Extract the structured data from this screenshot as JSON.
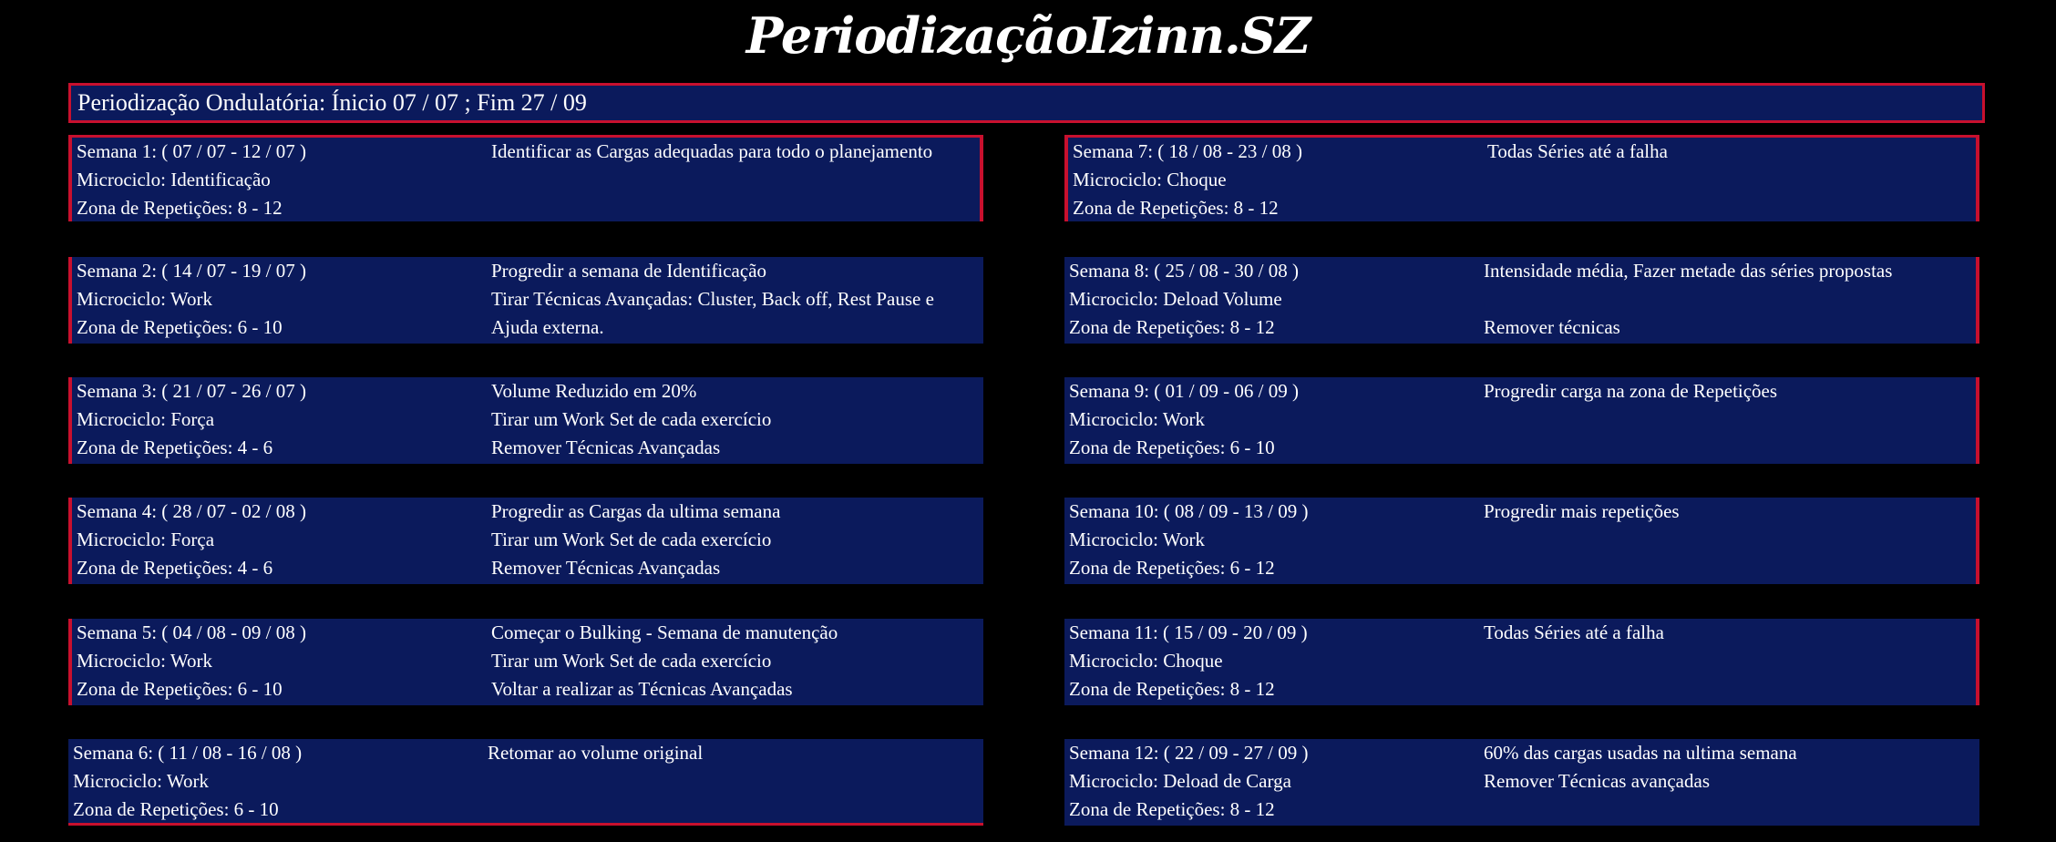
{
  "title": "PeriodizaçãoIzinn.SZ",
  "header": "Periodização Ondulatória:  Ínicio 07 / 07 ; Fim 27 / 09",
  "weeks_left": [
    {
      "semana": "Semana 1: ( 07 / 07 - 12 / 07 )",
      "microciclo": "Microciclo: Identificação",
      "zona": "Zona de Repetições: 8 - 12",
      "notes": [
        "Identificar as Cargas adequadas para todo o planejamento",
        "",
        ""
      ]
    },
    {
      "semana": "Semana 2: ( 14 / 07 - 19 / 07 )",
      "microciclo": "Microciclo: Work",
      "zona": "Zona de Repetições: 6 - 10",
      "notes": [
        "Progredir a semana de Identificação",
        "Tirar Técnicas Avançadas: Cluster, Back off, Rest Pause e",
        "Ajuda externa."
      ]
    },
    {
      "semana": "Semana 3: ( 21 / 07 - 26 / 07 )",
      "microciclo": "Microciclo: Força",
      "zona": "Zona de Repetições: 4 - 6",
      "notes": [
        "Volume Reduzido em 20%",
        "Tirar um Work Set de cada exercício",
        "Remover Técnicas Avançadas"
      ]
    },
    {
      "semana": "Semana 4: ( 28 / 07 - 02 / 08 )",
      "microciclo": "Microciclo: Força",
      "zona": "Zona de Repetições: 4 - 6",
      "notes": [
        "Progredir as Cargas da ultima semana",
        "Tirar um Work Set de cada exercício",
        "Remover Técnicas Avançadas"
      ]
    },
    {
      "semana": "Semana 5: ( 04 / 08 - 09 / 08 )",
      "microciclo": "Microciclo: Work",
      "zona": "Zona de Repetições: 6 - 10",
      "notes": [
        "Começar o Bulking - Semana de manutenção",
        "Tirar um Work Set de cada exercício",
        "Voltar a realizar as Técnicas Avançadas"
      ]
    },
    {
      "semana": "Semana 6: ( 11 / 08 - 16 / 08 )",
      "microciclo": "Microciclo: Work",
      "zona": "Zona de Repetições: 6 - 10",
      "notes": [
        "Retomar ao volume original",
        "",
        ""
      ]
    }
  ],
  "weeks_right": [
    {
      "semana": "Semana 7: ( 18 / 08 - 23 / 08 )",
      "microciclo": "Microciclo: Choque",
      "zona": "Zona de Repetições: 8 - 12",
      "notes": [
        "Todas Séries até a falha",
        "",
        ""
      ]
    },
    {
      "semana": "Semana 8: ( 25 / 08 - 30 / 08 )",
      "microciclo": "Microciclo: Deload Volume",
      "zona": "Zona de Repetições: 8 - 12",
      "notes": [
        "Intensidade média, Fazer metade das séries propostas",
        "",
        "Remover técnicas"
      ]
    },
    {
      "semana": "Semana 9: ( 01 / 09 - 06 / 09 )",
      "microciclo": "Microciclo: Work",
      "zona": "Zona de Repetições: 6 - 10",
      "notes": [
        "Progredir carga na zona de Repetições",
        "",
        ""
      ]
    },
    {
      "semana": "Semana 10: ( 08 / 09 - 13 / 09 )",
      "microciclo": "Microciclo: Work",
      "zona": "Zona de Repetições: 6 - 12",
      "notes": [
        "Progredir mais repetições",
        "",
        ""
      ]
    },
    {
      "semana": "Semana 11: ( 15 / 09 - 20 / 09 )",
      "microciclo": "Microciclo: Choque",
      "zona": "Zona de Repetições: 8 - 12",
      "notes": [
        "Todas Séries até a falha",
        "",
        ""
      ]
    },
    {
      "semana": "Semana 12: ( 22 / 09 - 27 / 09 )",
      "microciclo": "Microciclo: Deload de Carga",
      "zona": "Zona de Repetições: 8 - 12",
      "notes": [
        "60% das cargas usadas na ultima semana",
        "Remover Técnicas avançadas",
        ""
      ]
    }
  ],
  "colors": {
    "background": "#000000",
    "panel": "#0b1a5c",
    "border": "#c8102e",
    "text": "#ffffff"
  }
}
